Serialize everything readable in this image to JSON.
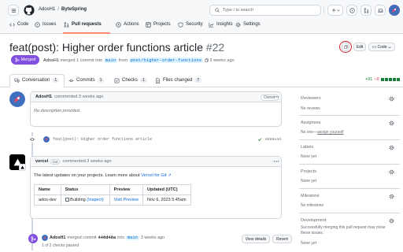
{
  "header": {
    "owner": "AdosH1",
    "separator": "/",
    "repo": "ByteSpring",
    "search_placeholder": "Type / to search",
    "tabs": [
      {
        "label": "Code",
        "icon": "code-icon"
      },
      {
        "label": "Issues",
        "icon": "issue-icon"
      },
      {
        "label": "Pull requests",
        "icon": "pull-request-icon"
      },
      {
        "label": "Actions",
        "icon": "play-icon"
      },
      {
        "label": "Projects",
        "icon": "table-icon"
      },
      {
        "label": "Security",
        "icon": "shield-icon"
      },
      {
        "label": "Insights",
        "icon": "graph-icon"
      },
      {
        "label": "Settings",
        "icon": "gear-icon"
      }
    ]
  },
  "pr": {
    "title": "feat(post): Higher order functions article",
    "number": "#22",
    "status": "Merged",
    "author": "AdosH1",
    "summary_mid": "merged 1 commit into",
    "base_branch": "main",
    "summary_from": "from",
    "head_branch": "post/higher-order-functions",
    "time": "3 weeks ago",
    "edit_label": "Edit",
    "code_label": "Code"
  },
  "pr_tabs": [
    {
      "label": "Conversation",
      "count": "1"
    },
    {
      "label": "Commits",
      "count": "1"
    },
    {
      "label": "Checks",
      "count": "1"
    },
    {
      "label": "Files changed",
      "count": "7"
    }
  ],
  "diffstat": {
    "added": "+91",
    "removed": "−0"
  },
  "comment1": {
    "author": "AdosH1",
    "action": "commented 3 weeks ago",
    "role": "Owner",
    "body": "No description provided."
  },
  "commit": {
    "message": "feat(post): Higher order functions article",
    "sha": "6868e4d"
  },
  "vercel": {
    "author": "vercel",
    "bot": "bot",
    "action": "commented 3 weeks ago",
    "intro": "The latest updates on your projects. Learn more about",
    "link": "Vercel for Git ↗",
    "columns": [
      "Name",
      "Status",
      "Preview",
      "Updated (UTC)"
    ],
    "row": {
      "name": "ados-dev",
      "status": "Building",
      "inspect": "(Inspect)",
      "preview": "Visit Preview",
      "updated": "Nov 6, 2023 5:45am"
    }
  },
  "merged_event": {
    "author": "AdosH1",
    "text": "merged commit",
    "sha": "448d48a",
    "into": "into",
    "branch": "main",
    "time": "3 weeks ago",
    "checks": "1 of 2 checks passed",
    "view_details": "View details",
    "revert": "Revert"
  },
  "sidebar": {
    "reviewers": {
      "title": "Reviewers",
      "value": "No reviews"
    },
    "assignees": {
      "title": "Assignees",
      "value": "No one—",
      "link": "assign yourself"
    },
    "labels": {
      "title": "Labels",
      "value": "None yet"
    },
    "projects": {
      "title": "Projects",
      "value": "None yet"
    },
    "milestone": {
      "title": "Milestone",
      "value": "No milestone"
    },
    "development": {
      "title": "Development",
      "value": "Successfully merging this pull request may close these issues.",
      "none": "None yet"
    }
  },
  "colors": {
    "merged": "#8250df",
    "accent": "#fd8c73",
    "link": "#0969da",
    "highlight": "#cf222e"
  }
}
